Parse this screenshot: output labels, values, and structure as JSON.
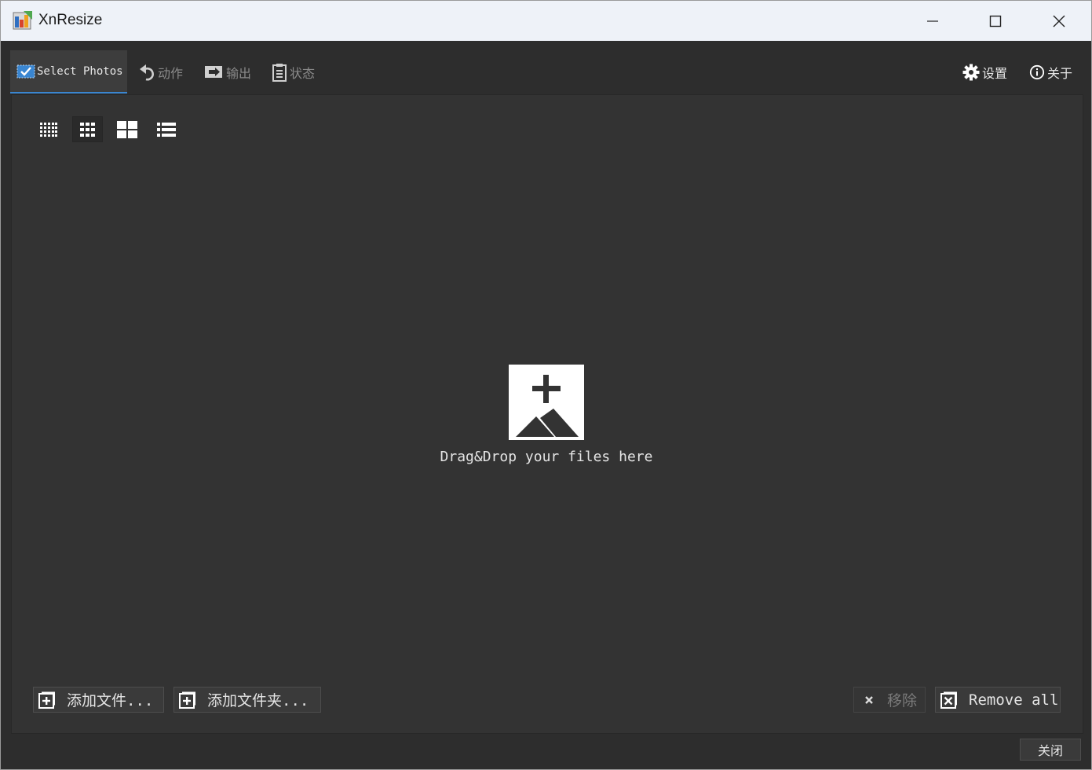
{
  "window": {
    "title": "XnResize"
  },
  "toolbar": {
    "tabs": [
      {
        "label": "Select Photos"
      },
      {
        "label": "动作"
      },
      {
        "label": "输出"
      },
      {
        "label": "状态"
      }
    ],
    "settings_label": "设置",
    "about_label": "关于"
  },
  "view_modes": [
    "small-grid",
    "medium-grid",
    "large-grid",
    "list"
  ],
  "main": {
    "drop_text": "Drag&Drop your files here",
    "add_files_label": "添加文件...",
    "add_folder_label": "添加文件夹...",
    "remove_label": "移除",
    "remove_all_label": "Remove all"
  },
  "footer": {
    "close_label": "关闭"
  },
  "colors": {
    "accent": "#3a86d1",
    "background": "#2d2d2d",
    "panel": "#333333"
  }
}
